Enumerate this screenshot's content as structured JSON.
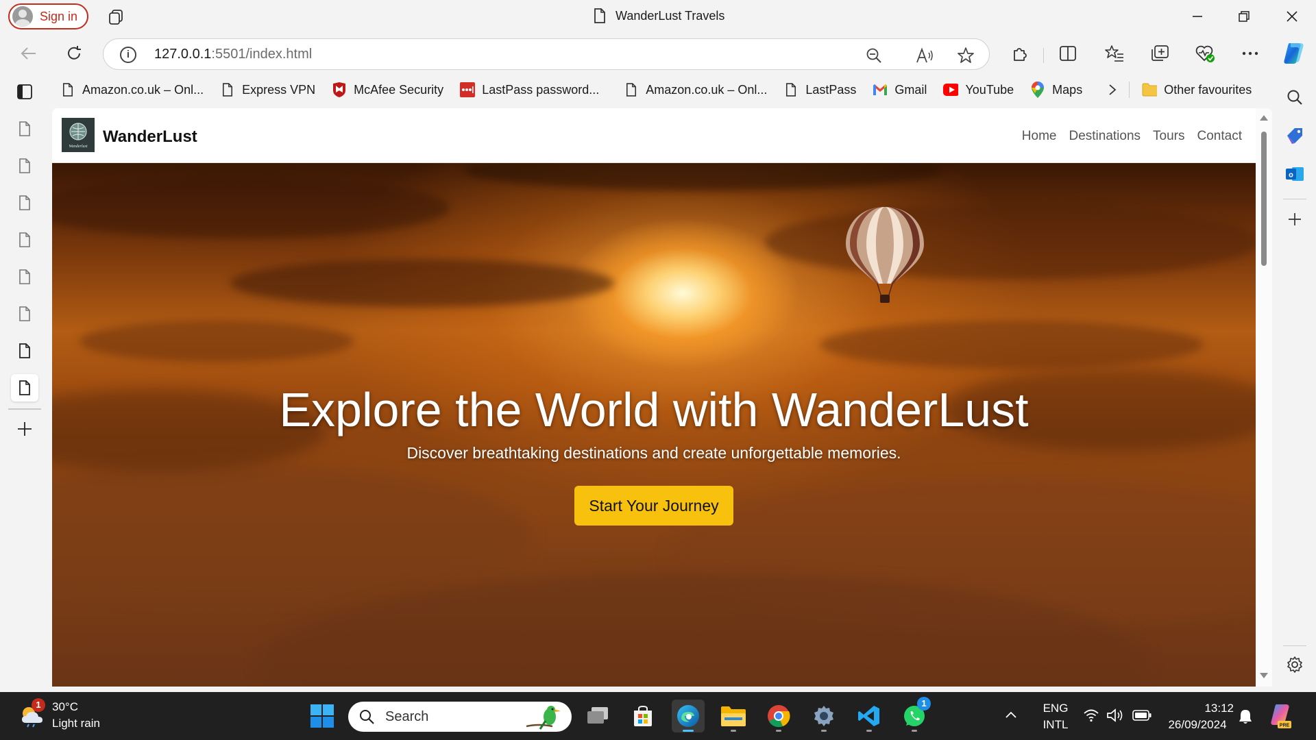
{
  "browser": {
    "signin_label": "Sign in",
    "tab_title": "WanderLust Travels",
    "url_host": "127.0.0.1",
    "url_rest": ":5501/index.html"
  },
  "favourites": [
    {
      "label": "Amazon.co.uk – Onl...",
      "icon": "page-icon"
    },
    {
      "label": "Express VPN",
      "icon": "page-icon"
    },
    {
      "label": "McAfee Security",
      "icon": "mcafee-icon"
    },
    {
      "label": "LastPass password...",
      "icon": "lastpass-icon"
    },
    {
      "label": "Amazon.co.uk – Onl...",
      "icon": "page-icon"
    },
    {
      "label": "LastPass",
      "icon": "page-icon"
    },
    {
      "label": "Gmail",
      "icon": "gmail-icon"
    },
    {
      "label": "YouTube",
      "icon": "youtube-icon"
    },
    {
      "label": "Maps",
      "icon": "maps-icon"
    }
  ],
  "other_favourites": "Other favourites",
  "site": {
    "brand": "WanderLust",
    "logo_text": "Wanderlust",
    "nav": [
      "Home",
      "Destinations",
      "Tours",
      "Contact"
    ],
    "hero_title": "Explore the World with WanderLust",
    "hero_subtitle": "Discover breathtaking destinations and create unforgettable memories.",
    "cta_label": "Start Your Journey"
  },
  "taskbar": {
    "weather_temp": "30°C",
    "weather_desc": "Light rain",
    "weather_badge": "1",
    "search_placeholder": "Search",
    "whatsapp_badge": "1",
    "lang_top": "ENG",
    "lang_bottom": "INTL",
    "time": "13:12",
    "date": "26/09/2024"
  },
  "colors": {
    "cta": "#f7c10d",
    "signin_accent": "#c42b1c",
    "taskbar": "#202020"
  }
}
